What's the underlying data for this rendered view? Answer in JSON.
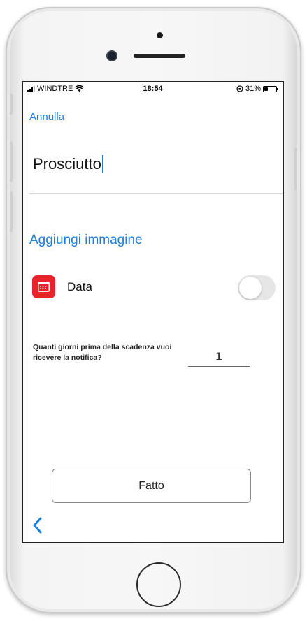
{
  "status_bar": {
    "carrier": "WINDTRE",
    "time": "18:54",
    "battery": "31%"
  },
  "header": {
    "cancel_label": "Annulla"
  },
  "form": {
    "name_value": "Prosciutto",
    "add_image_label": "Aggiungi immagine",
    "date_label": "Data",
    "date_toggle_on": false,
    "days_question": "Quanti giorni prima della scadenza vuoi ricevere la notifica?",
    "days_value": "1"
  },
  "footer": {
    "done_label": "Fatto"
  },
  "icons": {
    "signal": "signal-bars-icon",
    "wifi": "wifi-icon",
    "orientation_lock": "orientation-lock-icon",
    "battery": "battery-icon",
    "calendar": "calendar-icon",
    "back": "chevron-left-icon"
  },
  "colors": {
    "accent": "#1a7fe0",
    "calendar_red": "#e8242b",
    "toggle_off": "#e6e6e6"
  }
}
